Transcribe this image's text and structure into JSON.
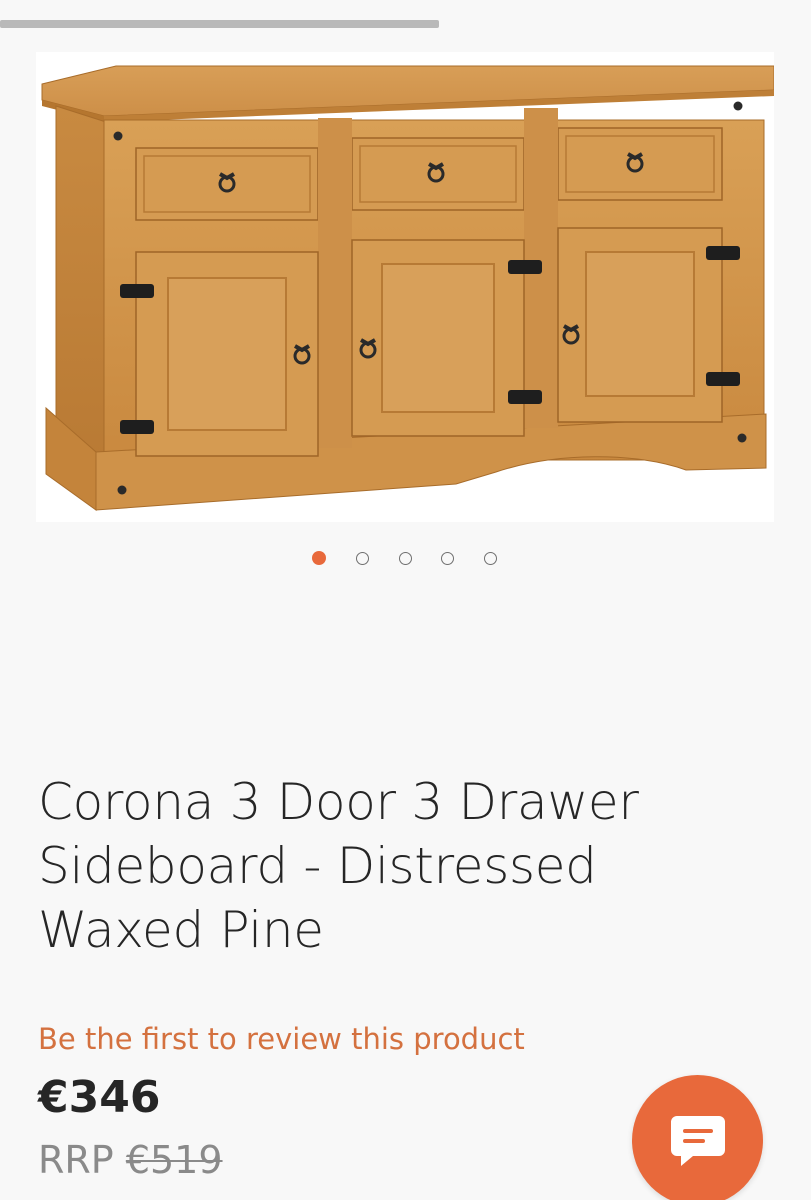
{
  "product": {
    "title": "Corona 3 Door 3 Drawer Sideboard - Distressed Waxed Pine",
    "review_link": "Be the first to review this product",
    "price": "€346",
    "rrp_label": "RRP",
    "rrp_price": "€519",
    "image_alt": "Corona 3 Door 3 Drawer Sideboard - Distressed Waxed Pine"
  },
  "carousel": {
    "total": 5,
    "active_index": 0
  },
  "icons": {
    "chat": "chat-bubble-icon"
  },
  "colors": {
    "accent": "#e8693b",
    "review_link": "#d4713f",
    "text": "#262626",
    "muted": "#8a8a8a",
    "background": "#f8f8f8"
  }
}
